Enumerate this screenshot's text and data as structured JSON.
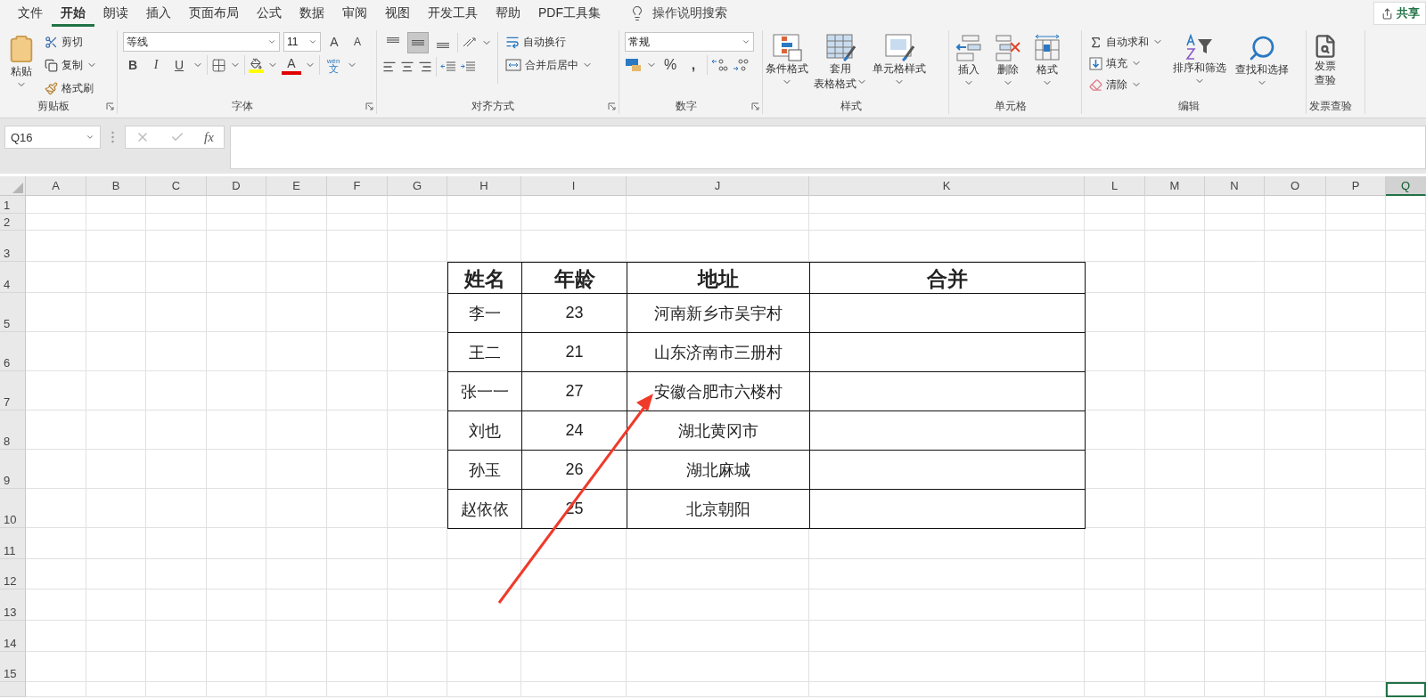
{
  "menu_tabs": [
    {
      "label": "文件",
      "selected": false
    },
    {
      "label": "开始",
      "selected": true
    },
    {
      "label": "朗读",
      "selected": false
    },
    {
      "label": "插入",
      "selected": false
    },
    {
      "label": "页面布局",
      "selected": false
    },
    {
      "label": "公式",
      "selected": false
    },
    {
      "label": "数据",
      "selected": false
    },
    {
      "label": "审阅",
      "selected": false
    },
    {
      "label": "视图",
      "selected": false
    },
    {
      "label": "开发工具",
      "selected": false
    },
    {
      "label": "帮助",
      "selected": false
    },
    {
      "label": "PDF工具集",
      "selected": false
    }
  ],
  "search": {
    "placeholder": "操作说明搜索"
  },
  "share_button": "共享",
  "ribbon": {
    "clipboard": {
      "paste": "粘贴",
      "cut": "剪切",
      "copy": "复制",
      "format_painter": "格式刷",
      "title": "剪贴板"
    },
    "font": {
      "font_name": "等线",
      "font_size": "11",
      "grow": "A",
      "shrink": "A",
      "bold": "B",
      "italic": "I",
      "underline": "U",
      "font_color": "A",
      "phonetic_top": "wén",
      "phonetic": "文",
      "title": "字体"
    },
    "alignment": {
      "vertical_align": [
        {
          "selected": false
        },
        {
          "selected": true
        },
        {
          "selected": false
        }
      ],
      "wrap_text": "自动换行",
      "merge_center": "合并后居中",
      "title": "对齐方式"
    },
    "number": {
      "format": "常规",
      "percent": "%",
      "comma": ",",
      "title": "数字"
    },
    "styles": {
      "conditional": "条件格式",
      "table_top": "套用",
      "table_bottom": "表格格式",
      "cell_styles": "单元格样式",
      "title": "样式"
    },
    "cells": {
      "insert": "插入",
      "delete": "删除",
      "format": "格式",
      "title": "单元格"
    },
    "editing": {
      "autosum": "自动求和",
      "fill": "填充",
      "clear": "清除",
      "sort_filter": "排序和筛选",
      "find_select": "查找和选择",
      "title": "编辑"
    },
    "invoice": {
      "check_top": "发票",
      "check_bottom": "查验",
      "title": "发票查验"
    }
  },
  "formula_bar": {
    "name_box": "Q16",
    "fx": "fx"
  },
  "sheet": {
    "columns": [
      {
        "label": "A",
        "selected": false
      },
      {
        "label": "B",
        "selected": false
      },
      {
        "label": "C",
        "selected": false
      },
      {
        "label": "D",
        "selected": false
      },
      {
        "label": "E",
        "selected": false
      },
      {
        "label": "F",
        "selected": false
      },
      {
        "label": "G",
        "selected": false
      },
      {
        "label": "H",
        "selected": false
      },
      {
        "label": "I",
        "selected": false
      },
      {
        "label": "J",
        "selected": false
      },
      {
        "label": "K",
        "selected": false
      },
      {
        "label": "L",
        "selected": false
      },
      {
        "label": "M",
        "selected": false
      },
      {
        "label": "N",
        "selected": false
      },
      {
        "label": "O",
        "selected": false
      },
      {
        "label": "P",
        "selected": false
      },
      {
        "label": "Q",
        "selected": true
      }
    ],
    "rows": [
      "1",
      "2",
      "3",
      "4",
      "5",
      "6",
      "7",
      "8",
      "9",
      "10",
      "11",
      "12",
      "13",
      "14",
      "15"
    ],
    "table": {
      "header": [
        "姓名",
        "年龄",
        "地址",
        "合并"
      ],
      "rows": [
        [
          "李一",
          "23",
          "河南新乡市吴宇村",
          ""
        ],
        [
          "王二",
          "21",
          "山东济南市三册村",
          ""
        ],
        [
          "张一一",
          "27",
          "安徽合肥市六楼村",
          ""
        ],
        [
          "刘也",
          "24",
          "湖北黄冈市",
          ""
        ],
        [
          "孙玉",
          "26",
          "湖北麻城",
          ""
        ],
        [
          "赵依依",
          "25",
          "北京朝阳",
          ""
        ]
      ]
    }
  }
}
